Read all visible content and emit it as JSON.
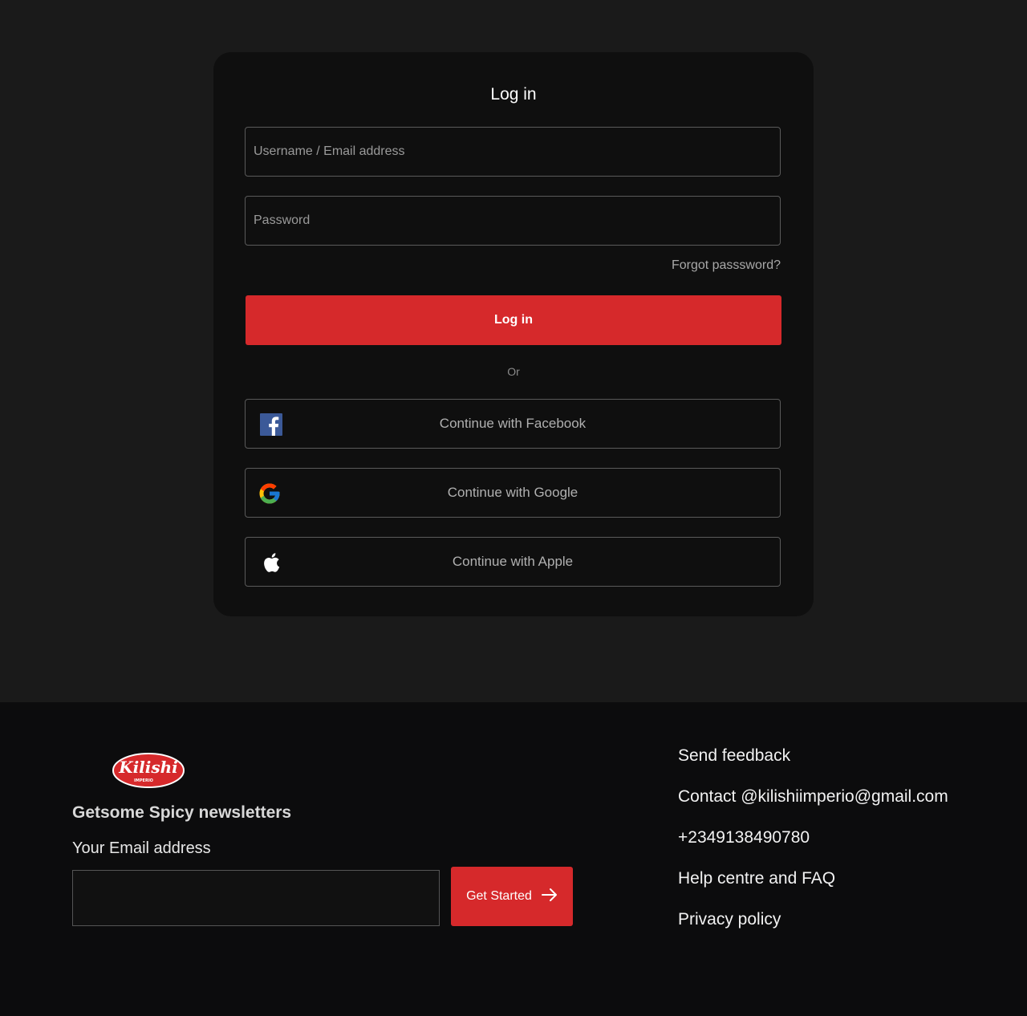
{
  "login": {
    "title": "Log in",
    "username_placeholder": "Username / Email address",
    "password_placeholder": "Password",
    "forgot": "Forgot passsword?",
    "submit": "Log in",
    "or": "Or",
    "facebook": "Continue with Facebook",
    "google": "Continue with Google",
    "apple": "Continue with Apple"
  },
  "footer": {
    "logo_text": "Kilishi",
    "logo_subtext": "IMPERIO",
    "newsletter_title": "Getsome Spicy newsletters",
    "email_label": "Your Email address",
    "email_value": "",
    "get_started": "Get Started",
    "links": [
      "Send feedback",
      "Contact @kilishiimperio@gmail.com",
      "+2349138490780",
      "Help centre and FAQ",
      "Privacy policy"
    ]
  },
  "colors": {
    "accent": "#d6292b",
    "background": "#1a1a1a",
    "card": "#0f0f0f",
    "footer": "#0c0c0d"
  },
  "icons": {
    "facebook": "facebook-icon",
    "google": "google-icon",
    "apple": "apple-icon",
    "arrow": "arrow-right-icon"
  }
}
